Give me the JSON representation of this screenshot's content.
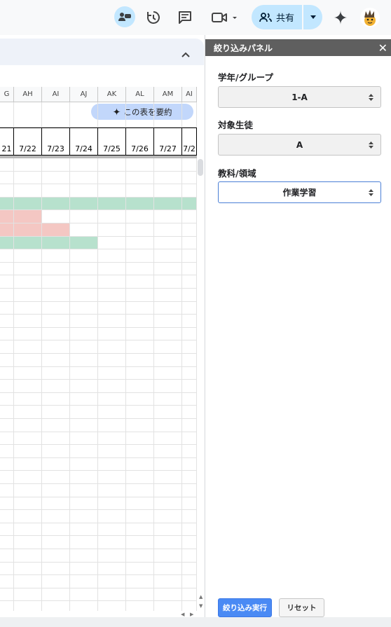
{
  "toolbar": {
    "icons": [
      "meet-presence-icon",
      "history-icon",
      "comment-icon",
      "video-call-icon",
      "gemini-icon"
    ],
    "share_label": "共有"
  },
  "sheet": {
    "summarize_label": "この表を要約",
    "columns": [
      "G",
      "AH",
      "AI",
      "AJ",
      "AK",
      "AL",
      "AM",
      "AI"
    ],
    "dates": [
      "21",
      "7/22",
      "7/23",
      "7/24",
      "7/25",
      "7/26",
      "7/27",
      "7/2"
    ],
    "colors": {
      "green": "#b7e1cd",
      "pink": "#f4c7c3"
    },
    "colored_rows": [
      {
        "row": 3,
        "color": "green",
        "from_col": 0,
        "to_col": 7
      },
      {
        "row": 4,
        "color": "pink",
        "from_col": 0,
        "to_col": 1
      },
      {
        "row": 5,
        "color": "pink",
        "from_col": 0,
        "to_col": 2
      },
      {
        "row": 6,
        "color": "green",
        "from_col": 0,
        "to_col": 3
      }
    ]
  },
  "panel": {
    "title": "絞り込みパネル",
    "close_glyph": "✕",
    "fields": [
      {
        "label": "学年/グループ",
        "value": "1-A"
      },
      {
        "label": "対象生徒",
        "value": "A"
      },
      {
        "label": "教科/領域",
        "value": "作業学習"
      }
    ],
    "run_label": "絞り込み実行",
    "reset_label": "リセット"
  }
}
